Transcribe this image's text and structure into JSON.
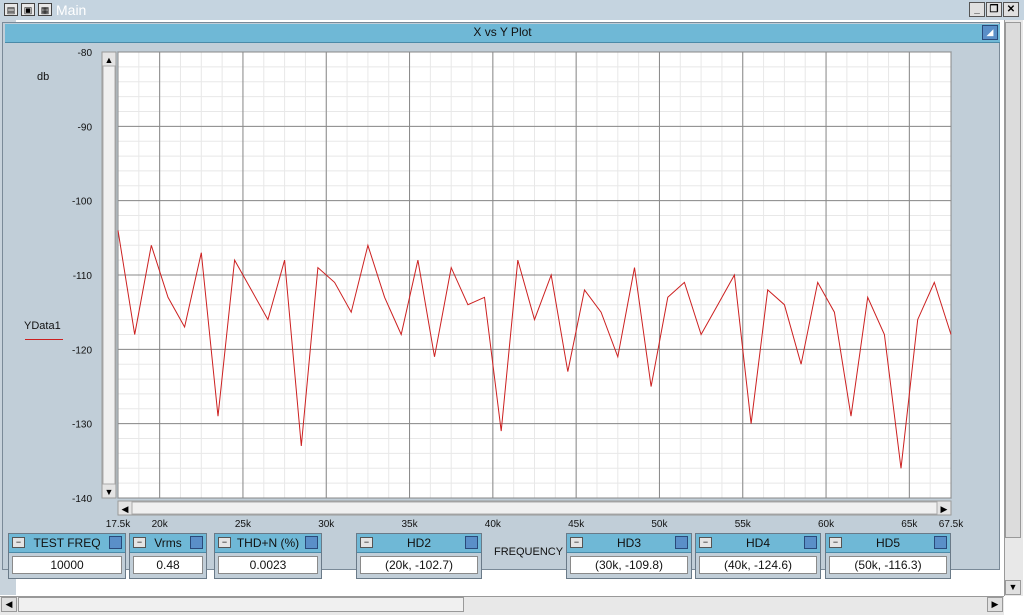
{
  "window": {
    "title": "Main"
  },
  "plot": {
    "title": "X vs Y Plot"
  },
  "chart_data": {
    "type": "line",
    "title": "",
    "ylabel": "db",
    "xlabel": "FREQUENCY",
    "xlim": [
      17500,
      67500
    ],
    "ylim": [
      -140,
      -80
    ],
    "x_ticks": [
      {
        "value": 17500,
        "label": "17.5k"
      },
      {
        "value": 20000,
        "label": "20k"
      },
      {
        "value": 25000,
        "label": "25k"
      },
      {
        "value": 30000,
        "label": "30k"
      },
      {
        "value": 35000,
        "label": "35k"
      },
      {
        "value": 40000,
        "label": "40k"
      },
      {
        "value": 45000,
        "label": "45k"
      },
      {
        "value": 50000,
        "label": "50k"
      },
      {
        "value": 55000,
        "label": "55k"
      },
      {
        "value": 60000,
        "label": "60k"
      },
      {
        "value": 65000,
        "label": "65k"
      },
      {
        "value": 67500,
        "label": "67.5k"
      }
    ],
    "y_ticks": [
      {
        "value": -80,
        "label": "-80"
      },
      {
        "value": -90,
        "label": "-90"
      },
      {
        "value": -100,
        "label": "-100"
      },
      {
        "value": -110,
        "label": "-110"
      },
      {
        "value": -120,
        "label": "-120"
      },
      {
        "value": -130,
        "label": "-130"
      },
      {
        "value": -140,
        "label": "-140"
      }
    ],
    "grid": true,
    "legend": "left",
    "series": [
      {
        "name": "YData1",
        "color": "#cc2020",
        "x": [
          17500,
          18500,
          19500,
          20500,
          21500,
          22500,
          23500,
          24500,
          25500,
          26500,
          27500,
          28500,
          29500,
          30500,
          31500,
          32500,
          33500,
          34500,
          35500,
          36500,
          37500,
          38500,
          39500,
          40500,
          41500,
          42500,
          43500,
          44500,
          45500,
          46500,
          47500,
          48500,
          49500,
          50500,
          51500,
          52500,
          53500,
          54500,
          55500,
          56500,
          57500,
          58500,
          59500,
          60500,
          61500,
          62500,
          63500,
          64500,
          65500,
          66500,
          67500
        ],
        "y": [
          -104,
          -118,
          -106,
          -113,
          -117,
          -107,
          -129,
          -108,
          -112,
          -116,
          -108,
          -133,
          -109,
          -111,
          -115,
          -106,
          -113,
          -118,
          -108,
          -121,
          -109,
          -114,
          -113,
          -131,
          -108,
          -116,
          -110,
          -123,
          -112,
          -115,
          -121,
          -109,
          -125,
          -113,
          -111,
          -118,
          -114,
          -110,
          -130,
          -112,
          -114,
          -122,
          -111,
          -115,
          -129,
          -113,
          -118,
          -136,
          -116,
          -111,
          -118
        ]
      }
    ]
  },
  "controls": [
    {
      "title": "TEST FREQ",
      "value": "10000"
    },
    {
      "title": "Vrms",
      "value": "0.48"
    },
    {
      "title": "THD+N (%)",
      "value": "0.0023"
    },
    {
      "title": "HD2",
      "value": "(20k, -102.7)"
    },
    {
      "title": "HD3",
      "value": "(30k, -109.8)"
    },
    {
      "title": "HD4",
      "value": "(40k, -124.6)"
    },
    {
      "title": "HD5",
      "value": "(50k, -116.3)"
    }
  ]
}
